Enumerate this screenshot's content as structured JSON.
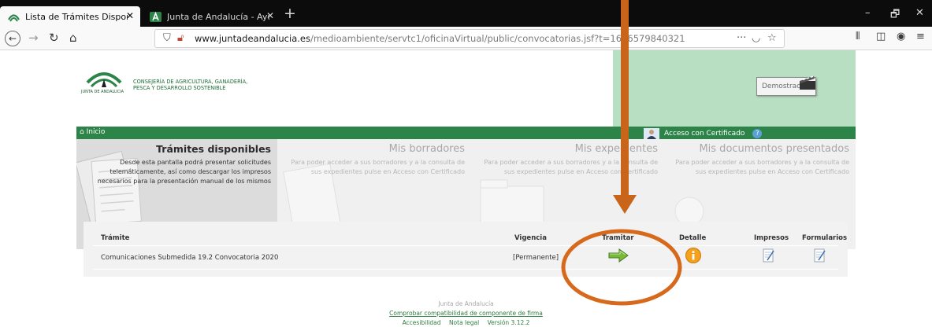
{
  "browser": {
    "tabs": [
      {
        "title": "Lista de Trámites Disponibles",
        "active": true
      },
      {
        "title": "Junta de Andalucía - Ayudas p",
        "active": false
      }
    ],
    "new_tab": "+",
    "url_host": "www.juntadeandalucia.es",
    "url_path": "/medioambiente/servtc1/oficinaVirtual/public/convocatorias.jsf?t=1616579840321",
    "url_more": "···",
    "window": {
      "minimize": "–",
      "restore": "🗗",
      "close": "✕"
    }
  },
  "header": {
    "logo_caption": "JUNTA DE ANDALUCIA",
    "consejeria_line1": "CONSEJERÍA DE AGRICULTURA, GANADERÍA,",
    "consejeria_line2": "PESCA Y DESARROLLO SOSTENIBLE",
    "demo_label": "Demostración"
  },
  "nav": {
    "inicio": "Inicio",
    "acceso": "Acceso con Certificado",
    "help": "?"
  },
  "panels": [
    {
      "title": "Trámites disponibles",
      "desc": "Desde esta pantalla podrá presentar solicitudes telemáticamente, así como descargar los impresos necesarios para la presentación manual de los mismos"
    },
    {
      "title": "Mis borradores",
      "desc": "Para poder acceder a sus borradores y a la consulta de sus expedientes pulse en Acceso con Certificado"
    },
    {
      "title": "Mis expedientes",
      "desc": "Para poder acceder a sus borradores y a la consulta de sus expedientes pulse en Acceso con Certificado"
    },
    {
      "title": "Mis documentos presentados",
      "desc": "Para poder acceder a sus borradores y a la consulta de sus expedientes pulse en Acceso con Certificado"
    }
  ],
  "table": {
    "headers": {
      "tramite": "Trámite",
      "vigencia": "Vigencia",
      "tramitar": "Tramitar",
      "detalle": "Detalle",
      "impresos": "Impresos",
      "formularios": "Formularios"
    },
    "rows": [
      {
        "tramite": "Comunicaciones Submedida 19.2 Convocatoria 2020",
        "vigencia": "[Permanente]"
      }
    ]
  },
  "footer": {
    "org": "Junta de Andalucía",
    "link": "Comprobar compatibilidad de componente de firma",
    "accesibilidad": "Accesibilidad",
    "nota_legal": "Nota legal",
    "version": "Versión 3.12.2"
  },
  "colors": {
    "green_bar": "#2c8448",
    "header_green": "#b9dfc3",
    "annotation_orange": "#d6691b",
    "arrow_brown": "#c8651a"
  }
}
